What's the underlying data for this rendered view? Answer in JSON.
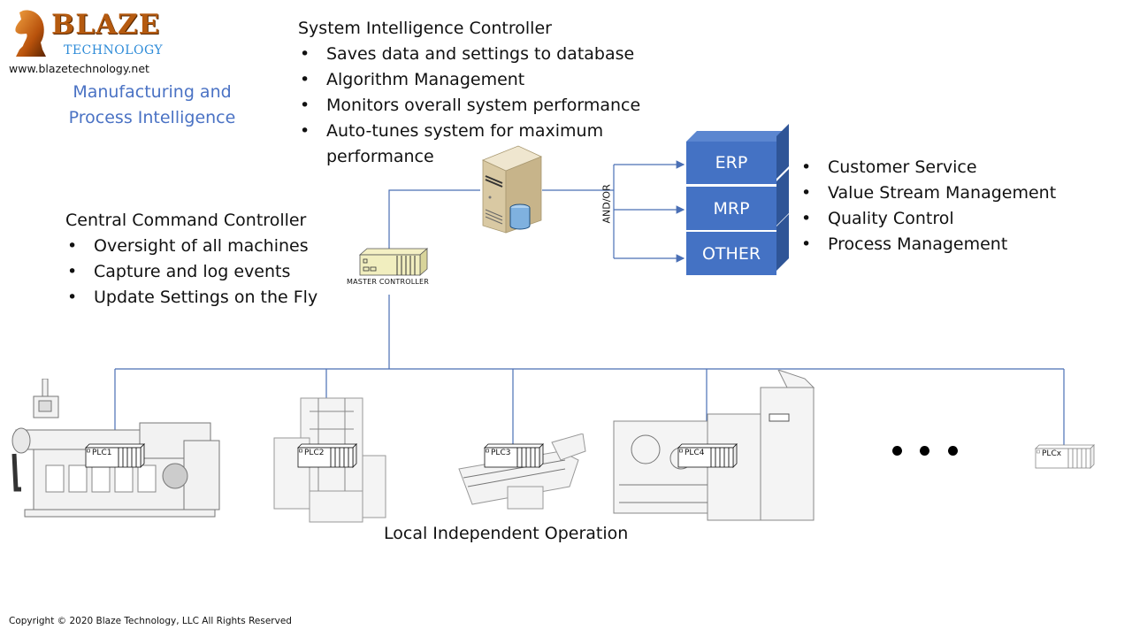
{
  "logo": {
    "brand": "BLAZE",
    "sub": "TECHNOLOGY",
    "url": "www.blazetechnology.net",
    "icon": "knight-chess-piece-icon"
  },
  "subtitle": [
    "Manufacturing and",
    "Process Intelligence"
  ],
  "system_controller": {
    "title": "System Intelligence Controller",
    "bullets": [
      "Saves data and settings to database",
      "Algorithm Management",
      "Monitors overall system performance",
      "Auto-tunes system for maximum",
      "performance"
    ]
  },
  "central_controller": {
    "title": "Central Command Controller",
    "bullets": [
      "Oversight of all machines",
      "Capture and log events",
      "Update Settings on the Fly"
    ]
  },
  "enterprise_systems": {
    "connector_label": "AND/OR",
    "boxes": [
      "ERP",
      "MRP",
      "OTHER"
    ],
    "color": "#4472c4",
    "bullets": [
      "Customer Service",
      "Value Stream Management",
      "Quality Control",
      "Process Management"
    ]
  },
  "master_controller_label": "MASTER CONTROLLER",
  "server_icon": "server-database-icon",
  "plcs": [
    "PLC1",
    "PLC2",
    "PLC3",
    "PLC4",
    "PLCx"
  ],
  "local_label": "Local Independent Operation",
  "bullet_char": "•",
  "line_color": "#4a6fb5",
  "footer": "Copyright © 2020 Blaze Technology, LLC All Rights Reserved"
}
